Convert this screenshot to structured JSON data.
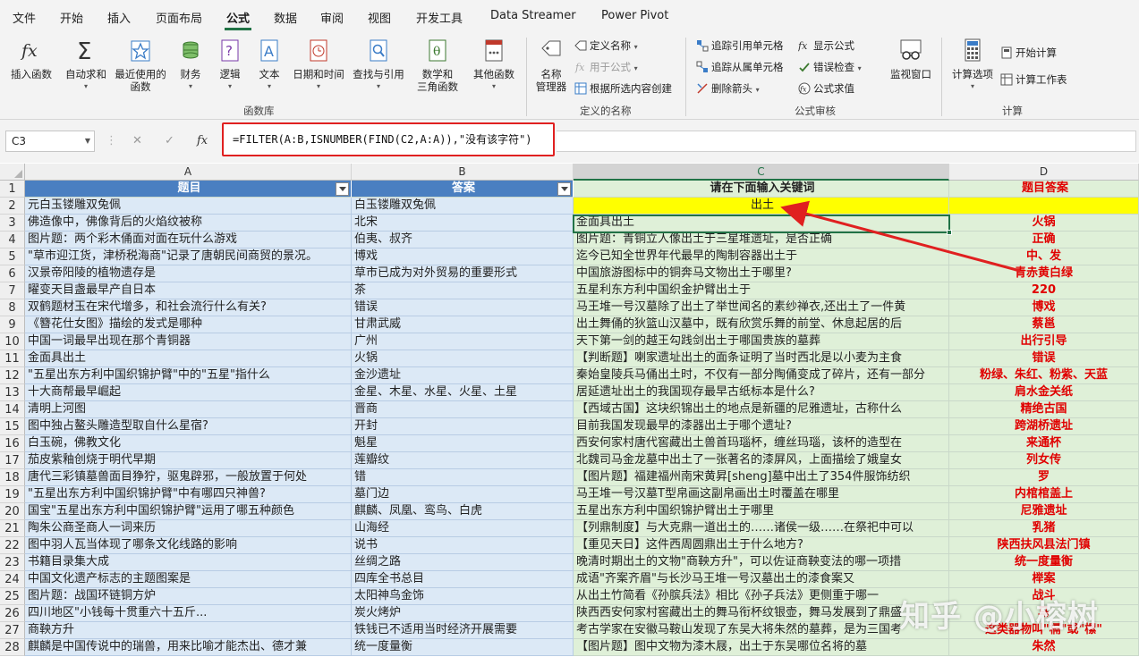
{
  "menu": {
    "tabs": [
      "文件",
      "开始",
      "插入",
      "页面布局",
      "公式",
      "数据",
      "审阅",
      "视图",
      "开发工具",
      "Data Streamer",
      "Power Pivot"
    ],
    "active": "公式"
  },
  "ribbon": {
    "insert_function": "插入函数",
    "autosum": "自动求和",
    "recent_line1": "最近使用的",
    "recent_line2": "函数",
    "financial": "财务",
    "logical": "逻辑",
    "text": "文本",
    "datetime": "日期和时间",
    "lookup": "查找与引用",
    "math_line1": "数学和",
    "math_line2": "三角函数",
    "other": "其他函数",
    "group_library": "函数库",
    "name_manager_line1": "名称",
    "name_manager_line2": "管理器",
    "define_name": "定义名称",
    "use_in_formula": "用于公式",
    "create_from_selection": "根据所选内容创建",
    "group_names": "定义的名称",
    "trace_precedents": "追踪引用单元格",
    "trace_dependents": "追踪从属单元格",
    "remove_arrows": "删除箭头",
    "show_formulas": "显示公式",
    "error_checking": "错误检查",
    "evaluate_formula": "公式求值",
    "group_audit": "公式审核",
    "watch_window": "监视窗口",
    "calc_options": "计算选项",
    "calc_now": "开始计算",
    "calc_sheet": "计算工作表",
    "group_calc": "计算"
  },
  "formula_bar": {
    "name_box": "C3",
    "cancel_glyph": "✕",
    "enter_glyph": "✓",
    "fx_glyph": "fx",
    "formula": "=FILTER(A:B,ISNUMBER(FIND(C2,A:A)),\"没有该字符\")"
  },
  "sheet": {
    "columns": [
      "A",
      "B",
      "C",
      "D"
    ],
    "header_row": {
      "a": "题目",
      "b": "答案",
      "c": "请在下面输入关键词",
      "d": "题目答案"
    },
    "keyword": "出土",
    "rows": [
      {
        "n": "2",
        "a": "元白玉镂雕双兔佩",
        "b": "白玉镂雕双兔佩",
        "c": "",
        "d": ""
      },
      {
        "n": "3",
        "a": "佛造像中，佛像背后的火焰纹被称",
        "b": "北宋",
        "c": "金面具出土",
        "d": "火锅"
      },
      {
        "n": "4",
        "a": "图片题：两个彩木俑面对面在玩什么游戏",
        "b": "伯夷、叔齐",
        "c": "图片题：青铜立人像出土于三星堆遗址，是否正确",
        "d": "正确"
      },
      {
        "n": "5",
        "a": "\"草市迎江货，津桥税海商\"记录了唐朝民间商贸的景况。",
        "b": "博戏",
        "c": "迄今已知全世界年代最早的陶制容器出土于",
        "d": "中、发"
      },
      {
        "n": "6",
        "a": "汉景帝阳陵的植物遗存是",
        "b": "草市已成为对外贸易的重要形式",
        "c": "中国旅游图标中的铜奔马文物出土于哪里?",
        "d": "青赤黄白绿"
      },
      {
        "n": "7",
        "a": "曜变天目盏最早产自日本",
        "b": "茶",
        "c": "五星利东方利中国织金护臂出土于",
        "d": "220"
      },
      {
        "n": "8",
        "a": "双鹤题材玉在宋代增多，和社会流行什么有关?",
        "b": "错误",
        "c": "马王堆一号汉墓除了出土了举世闻名的素纱禅衣,还出土了一件黄",
        "d": "博戏"
      },
      {
        "n": "9",
        "a": "《簪花仕女图》描绘的发式是哪种",
        "b": "甘肃武威",
        "c": "出土舞俑的狄篮山汉墓中，既有欣赏乐舞的前堂、休息起居的后",
        "d": "蔡邕"
      },
      {
        "n": "10",
        "a": "中国一词最早出现在那个青铜器",
        "b": "广州",
        "c": "天下第一剑的越王勾践剑出土于哪国贵族的墓葬",
        "d": "出行引导"
      },
      {
        "n": "11",
        "a": "金面具出土",
        "b": "火锅",
        "c": "【判断题】喇家遗址出土的面条证明了当时西北是以小麦为主食",
        "d": "错误"
      },
      {
        "n": "12",
        "a": "\"五星出东方利中国织锦护臂\"中的\"五星\"指什么",
        "b": "金沙遗址",
        "c": "秦始皇陵兵马俑出土时，不仅有一部分陶俑变成了碎片，还有一部分",
        "d": "粉绿、朱红、粉紫、天蓝"
      },
      {
        "n": "13",
        "a": "十大商帮最早崛起",
        "b": "金星、木星、水星、火星、土星",
        "c": "居延遗址出土的我国现存最早古纸标本是什么?",
        "d": "肩水金关纸"
      },
      {
        "n": "14",
        "a": "清明上河图",
        "b": "晋商",
        "c": "【西域古国】这块织锦出土的地点是新疆的尼雅遗址，古称什么",
        "d": "精绝古国"
      },
      {
        "n": "15",
        "a": "图中独占鳌头雕造型取自什么星宿?",
        "b": "开封",
        "c": "目前我国发现最早的漆器出土于哪个遗址?",
        "d": "跨湖桥遗址"
      },
      {
        "n": "16",
        "a": "白玉碗，佛教文化",
        "b": "魁星",
        "c": "西安何家村唐代窖藏出土兽首玛瑙杯，缠丝玛瑙，该杯的造型在",
        "d": "来通杯"
      },
      {
        "n": "17",
        "a": "茄皮紫釉创烧于明代早期",
        "b": "莲瓣纹",
        "c": "北魏司马金龙墓中出土了一张著名的漆屏风，上面描绘了娥皇女",
        "d": "列女传"
      },
      {
        "n": "18",
        "a": "唐代三彩镇墓兽面目狰狞，驱鬼辟邪，一般放置于何处",
        "b": "错",
        "c": "【图片题】福建福州南宋黄昇[sheng]墓中出土了354件服饰纺织",
        "d": "罗"
      },
      {
        "n": "19",
        "a": "\"五星出东方利中国织锦护臂\"中有哪四只神兽?",
        "b": "墓门边",
        "c": "马王堆一号汉墓T型帛画这副帛画出土时覆盖在哪里",
        "d": "内棺棺盖上"
      },
      {
        "n": "20",
        "a": "国宝\"五星出东方利中国织锦护臂\"运用了哪五种颜色",
        "b": "麒麟、凤凰、鸾鸟、白虎",
        "c": "五星出东方利中国织锦护臂出土于哪里",
        "d": "尼雅遗址"
      },
      {
        "n": "21",
        "a": "陶朱公商圣商人一词来历",
        "b": "山海经",
        "c": "【列鼎制度】与大克鼎一道出土的……诸侯一级……在祭祀中可以",
        "d": "乳猪"
      },
      {
        "n": "22",
        "a": "图中羽人瓦当体现了哪条文化线路的影响",
        "b": "说书",
        "c": "【重见天日】这件西周圆鼎出土于什么地方?",
        "d": "陕西扶风县法门镇"
      },
      {
        "n": "23",
        "a": "书籍目录集大成",
        "b": "丝绸之路",
        "c": "晚清时期出土的文物\"商鞅方升\"，可以佐证商鞅变法的哪一项措",
        "d": "统一度量衡"
      },
      {
        "n": "24",
        "a": "中国文化遗产标志的主题图案是",
        "b": "四库全书总目",
        "c": "成语\"齐案齐眉\"与长沙马王堆一号汉墓出土的漆食案又",
        "d": "榉案"
      },
      {
        "n": "25",
        "a": "图片题：战国环链铜方炉",
        "b": "太阳神鸟金饰",
        "c": "从出土竹简看《孙膑兵法》相比《孙子兵法》更侧重于哪一",
        "d": "战斗"
      },
      {
        "n": "26",
        "a": "四川地区\"小钱每十贯重六十五斤...",
        "b": "炭火烤炉",
        "c": "陕西西安何家村窖藏出土的舞马衔杯纹银壶，舞马发展到了鼎盛",
        "d": "马"
      },
      {
        "n": "27",
        "a": "商鞅方升",
        "b": "铁钱已不适用当时经济开展需要",
        "c": "考古学家在安徽马鞍山发现了东吴大将朱然的墓葬，是为三国考",
        "d": "这类器物叫\"槅\"或\"樏\""
      },
      {
        "n": "28",
        "a": "麒麟是中国传说中的瑞兽，用来比喻才能杰出、德才兼",
        "b": "统一度量衡",
        "c": "【图片题】图中文物为漆木屐，出土于东吴哪位名将的墓",
        "d": "朱然"
      }
    ]
  },
  "watermark": "知乎 @小榕树",
  "colors": {
    "excel_green": "#217346",
    "header_blue": "#4a7fc1",
    "cell_blue": "#dce9f6",
    "cell_green": "#dff0d8",
    "keyword_yellow": "#ffff00",
    "answer_red": "#e00000",
    "annotation_red": "#e02020"
  }
}
